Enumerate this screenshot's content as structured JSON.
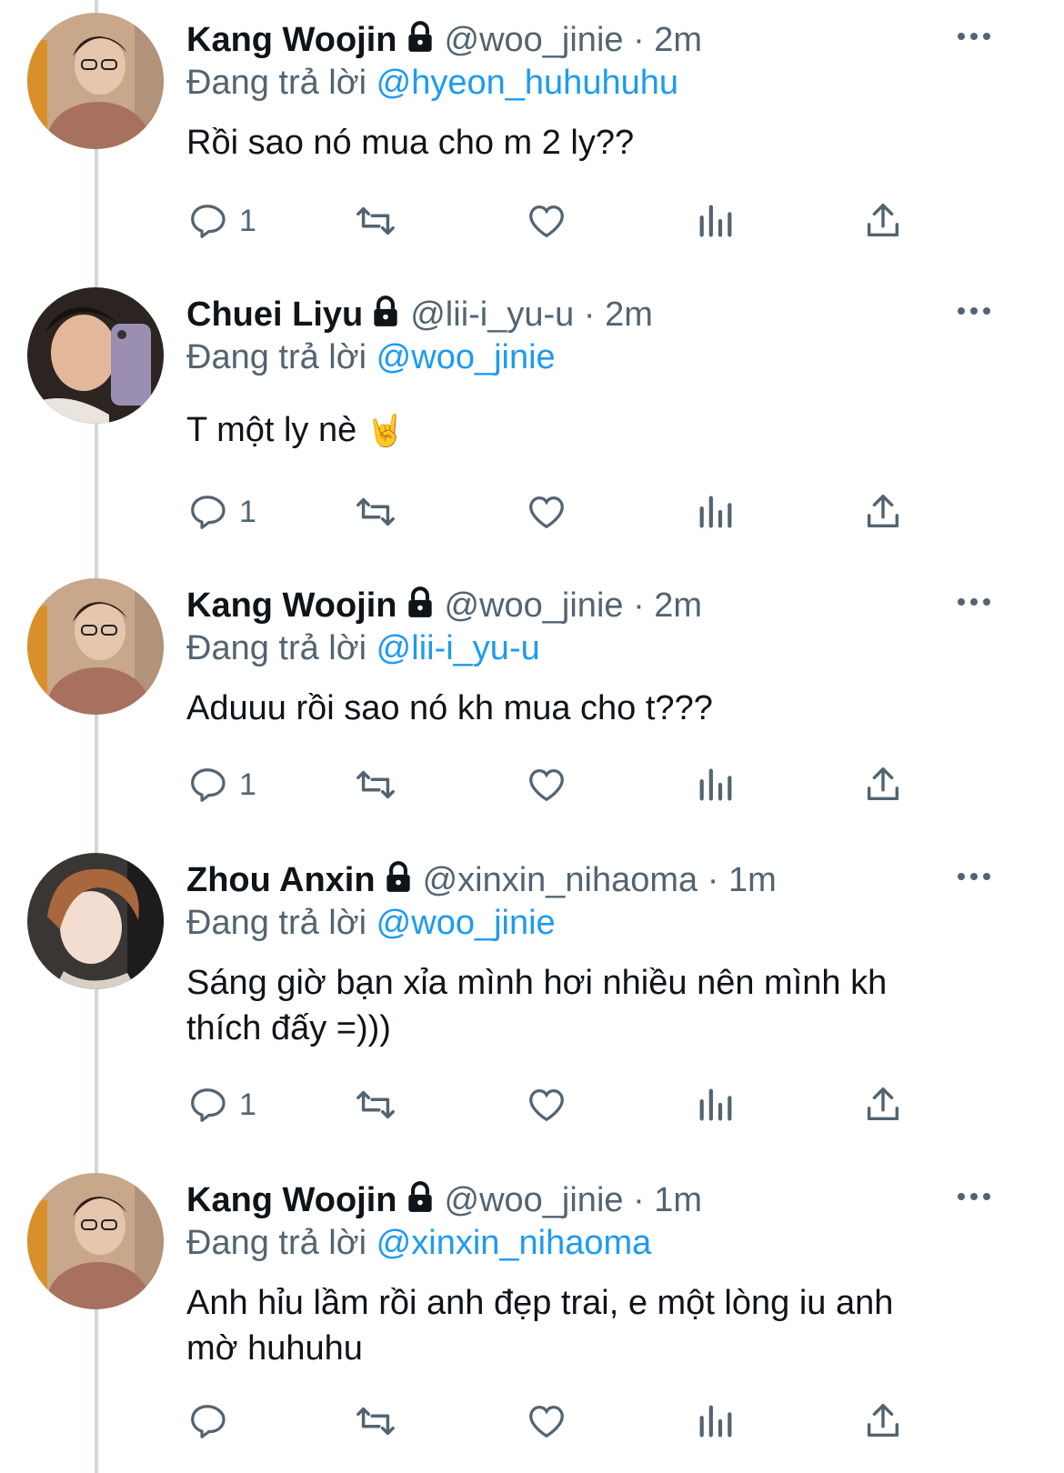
{
  "reply_prefix": "Đang trả lời",
  "colors": {
    "accent": "#1d9bf0",
    "secondary_text": "#536471",
    "thread_line": "#cfd9de"
  },
  "tweets": [
    {
      "avatar": "avatar-kang-woojin",
      "name": "Kang Woojin",
      "handle": "@woo_jinie",
      "dot": "·",
      "time": "2m",
      "replying_to": "@hyeon_huhuhuhu",
      "text": "Rồi sao nó mua cho m 2 ly??",
      "reply_count": "1"
    },
    {
      "avatar": "avatar-chuei-liyu",
      "name": "Chuei Liyu",
      "handle": "@lii-i_yu-u",
      "dot": "·",
      "time": "2m",
      "replying_to": "@woo_jinie",
      "text": "T một ly nè",
      "emoji": "🤘",
      "reply_count": "1"
    },
    {
      "avatar": "avatar-kang-woojin",
      "name": "Kang Woojin",
      "handle": "@woo_jinie",
      "dot": "·",
      "time": "2m",
      "replying_to": "@lii-i_yu-u",
      "text": "Aduuu rồi sao nó kh mua cho t???",
      "reply_count": "1"
    },
    {
      "avatar": "avatar-zhou-anxin",
      "name": "Zhou Anxin",
      "handle": "@xinxin_nihaoma",
      "dot": "·",
      "time": "1m",
      "replying_to": "@woo_jinie",
      "text_lines": [
        "Sáng giờ bạn xỉa mình hơi nhiều nên mình kh",
        "thích đấy =)))"
      ],
      "reply_count": "1"
    },
    {
      "avatar": "avatar-kang-woojin",
      "name": "Kang Woojin",
      "handle": "@woo_jinie",
      "dot": "·",
      "time": "1m",
      "replying_to": "@xinxin_nihaoma",
      "text_lines": [
        "Anh hỉu lầm rồi anh đẹp trai, e một lòng iu anh",
        "mờ huhuhu"
      ],
      "reply_count": ""
    }
  ]
}
